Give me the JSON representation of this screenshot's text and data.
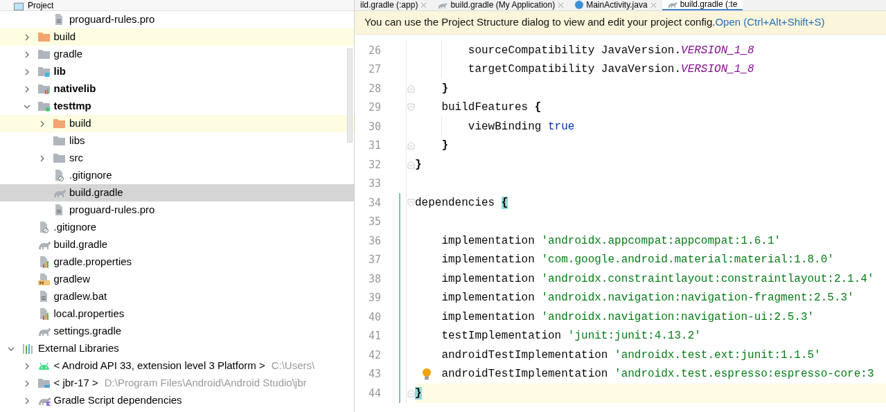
{
  "project_panel": {
    "title": "Project",
    "tree": [
      {
        "children": [
          {
            "children": [
              {
                "name": "proguard-rules.pro",
                "kind": "text-file",
                "selected": false,
                "highlighted": false
              }
            ]
          },
          {
            "name": "build",
            "kind": "excluded-folder",
            "expanded": false,
            "selected": false,
            "highlighted": true
          },
          {
            "name": "gradle",
            "kind": "folder",
            "expanded": false,
            "selected": false,
            "highlighted": false
          },
          {
            "name": "lib",
            "kind": "module",
            "expanded": false,
            "selected": false,
            "highlighted": false
          },
          {
            "name": "nativelib",
            "kind": "native-module",
            "expanded": false,
            "selected": false,
            "highlighted": false
          },
          {
            "name": "testtmp",
            "kind": "app-module",
            "expanded": true,
            "selected": false,
            "highlighted": false,
            "children": [
              {
                "name": "build",
                "kind": "excluded-folder",
                "expanded": false,
                "selected": false,
                "highlighted": true
              },
              {
                "name": "libs",
                "kind": "folder",
                "selected": false,
                "highlighted": false
              },
              {
                "name": "src",
                "kind": "folder",
                "expanded": false,
                "selected": false,
                "highlighted": false
              },
              {
                "name": ".gitignore",
                "kind": "ignore-file",
                "selected": false,
                "highlighted": false
              },
              {
                "name": "build.gradle",
                "kind": "gradle",
                "selected": true,
                "highlighted": false
              },
              {
                "name": "proguard-rules.pro",
                "kind": "text-file",
                "selected": false,
                "highlighted": false
              }
            ]
          },
          {
            "name": ".gitignore",
            "kind": "ignore-file",
            "selected": false,
            "highlighted": false
          },
          {
            "name": "build.gradle",
            "kind": "gradle",
            "selected": false,
            "highlighted": false
          },
          {
            "name": "gradle.properties",
            "kind": "properties",
            "selected": false,
            "highlighted": false
          },
          {
            "name": "gradlew",
            "kind": "shell",
            "selected": false,
            "highlighted": false
          },
          {
            "name": "gradlew.bat",
            "kind": "text-file",
            "selected": false,
            "highlighted": false
          },
          {
            "name": "local.properties",
            "kind": "properties",
            "selected": false,
            "highlighted": false
          },
          {
            "name": "settings.gradle",
            "kind": "gradle",
            "selected": false,
            "highlighted": false
          }
        ]
      },
      {
        "name": "External Libraries",
        "kind": "libraries",
        "expanded": true,
        "selected": false,
        "highlighted": false,
        "children": [
          {
            "name": "< Android API 33, extension level 3 Platform >",
            "path": "C:\\Users\\",
            "kind": "android",
            "expanded": false,
            "selected": false,
            "highlighted": false
          },
          {
            "name": "< jbr-17 >",
            "path": "D:\\Program Files\\Android\\Android Studio\\jbr",
            "kind": "jdk",
            "expanded": false,
            "selected": false,
            "highlighted": false
          },
          {
            "name": "Gradle Script dependencies",
            "kind": "gradle-kotlin",
            "expanded": false,
            "selected": false,
            "highlighted": false
          }
        ]
      }
    ]
  },
  "tabs": [
    {
      "label": "ild.gradle (:app)",
      "kind": "plain",
      "selected": false
    },
    {
      "label": "build.gradle (My Application)",
      "kind": "gradle",
      "selected": false
    },
    {
      "label": "MainActivity.java",
      "kind": "java",
      "selected": false
    },
    {
      "label": "build.gradle (:te",
      "kind": "gradle",
      "selected": true
    }
  ],
  "banner": {
    "text": "You can use the Project Structure dialog to view and edit your project config.",
    "link": "Open (Ctrl+Alt+Shift+S)"
  },
  "editor": {
    "lines": [
      {
        "children": [
          {
            "children": [
              {
                "number": "26",
                "changed": false,
                "current": false,
                "tokens": [
                  {
                    "text": "sourceCompatibility JavaVersion.",
                    "kind": "plain"
                  },
                  {
                    "text": "VERSION_1_8",
                    "kind": "constant"
                  }
                ]
              },
              {
                "number": "27",
                "changed": false,
                "current": false,
                "tokens": [
                  {
                    "text": "targetCompatibility JavaVersion.",
                    "kind": "plain"
                  },
                  {
                    "text": "VERSION_1_8",
                    "kind": "constant"
                  }
                ]
              }
            ]
          },
          {
            "number": "28",
            "kind": "fold-end",
            "changed": false,
            "current": false,
            "tokens": [
              {
                "text": "}",
                "kind": "brace"
              }
            ]
          },
          {
            "number": "29",
            "kind": "fold-start",
            "changed": false,
            "current": false,
            "tokens": [
              {
                "text": "buildFeatures ",
                "kind": "plain"
              },
              {
                "text": "{",
                "kind": "brace"
              }
            ],
            "children": [
              {
                "number": "30",
                "changed": false,
                "current": false,
                "tokens": [
                  {
                    "text": "viewBinding ",
                    "kind": "plain"
                  },
                  {
                    "text": "true",
                    "kind": "keyword"
                  }
                ]
              }
            ]
          },
          {
            "number": "31",
            "kind": "fold-end",
            "changed": false,
            "current": false,
            "tokens": [
              {
                "text": "}",
                "kind": "brace"
              }
            ]
          }
        ]
      },
      {
        "number": "32",
        "kind": "fold-end",
        "changed": false,
        "current": false,
        "tokens": [
          {
            "text": "}",
            "kind": "brace"
          }
        ]
      },
      {
        "number": "33",
        "changed": false,
        "current": false
      },
      {
        "number": "34",
        "kind": "fold-start",
        "changed": true,
        "current": false,
        "tokens": [
          {
            "text": "dependencies ",
            "kind": "plain"
          },
          {
            "text": "{",
            "kind": "matched-brace"
          }
        ],
        "children": [
          {
            "number": "35",
            "changed": true,
            "current": false
          },
          {
            "number": "36",
            "changed": true,
            "current": false,
            "tokens": [
              {
                "text": "implementation ",
                "kind": "plain"
              },
              {
                "text": "'androidx.appcompat:appcompat:1.6.1'",
                "kind": "string"
              }
            ]
          },
          {
            "number": "37",
            "changed": true,
            "current": false,
            "tokens": [
              {
                "text": "implementation ",
                "kind": "plain"
              },
              {
                "text": "'com.google.android.material:material:1.8.0'",
                "kind": "string"
              }
            ]
          },
          {
            "number": "38",
            "changed": true,
            "current": false,
            "tokens": [
              {
                "text": "implementation ",
                "kind": "plain"
              },
              {
                "text": "'androidx.constraintlayout:constraintlayout:2.1.4'",
                "kind": "string"
              }
            ]
          },
          {
            "number": "39",
            "changed": true,
            "current": false,
            "tokens": [
              {
                "text": "implementation ",
                "kind": "plain"
              },
              {
                "text": "'androidx.navigation:navigation-fragment:2.5.3'",
                "kind": "string"
              }
            ]
          },
          {
            "number": "40",
            "changed": true,
            "current": false,
            "tokens": [
              {
                "text": "implementation ",
                "kind": "plain"
              },
              {
                "text": "'androidx.navigation:navigation-ui:2.5.3'",
                "kind": "string"
              }
            ]
          },
          {
            "number": "41",
            "changed": true,
            "current": false,
            "tokens": [
              {
                "text": "testImplementation ",
                "kind": "plain"
              },
              {
                "text": "'junit:junit:4.13.2'",
                "kind": "string"
              }
            ]
          },
          {
            "number": "42",
            "changed": true,
            "current": false,
            "tokens": [
              {
                "text": "androidTestImplementation ",
                "kind": "plain"
              },
              {
                "text": "'androidx.test.ext:junit:1.1.5'",
                "kind": "string"
              }
            ]
          },
          {
            "number": "43",
            "bulb": true,
            "changed": true,
            "current": false,
            "tokens": [
              {
                "text": "androidTestImplementation ",
                "kind": "plain"
              },
              {
                "text": "'androidx.test.espresso:espresso-core:3",
                "kind": "string"
              }
            ]
          }
        ]
      },
      {
        "number": "44",
        "kind": "fold-end",
        "changed": true,
        "current": true,
        "tokens": [
          {
            "text": "}",
            "kind": "matched-brace"
          }
        ]
      }
    ]
  }
}
